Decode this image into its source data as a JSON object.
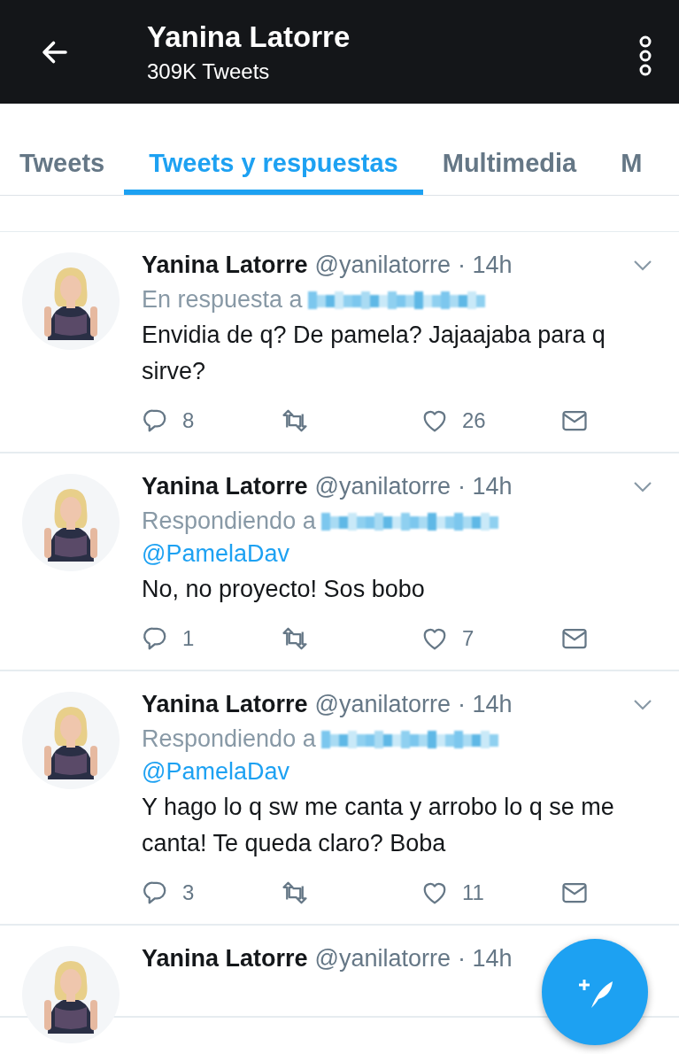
{
  "header": {
    "title": "Yanina Latorre",
    "subtitle": "309K Tweets"
  },
  "tabs": [
    {
      "label": "Tweets",
      "selected": false
    },
    {
      "label": "Tweets y respuestas",
      "selected": true
    },
    {
      "label": "Multimedia",
      "selected": false
    },
    {
      "label": "M",
      "selected": false
    }
  ],
  "tweets": [
    {
      "name": "Yanina Latorre",
      "handle": "@yanilatorre",
      "time": "· 14h",
      "reply_prefix": "En respuesta a",
      "reply_redacted": true,
      "text": "Envidia de q? De pamela? Jajaajaba para q sirve?",
      "replies": "8",
      "likes": "26"
    },
    {
      "name": "Yanina Latorre",
      "handle": "@yanilatorre",
      "time": "· 14h",
      "reply_prefix": "Respondiendo a",
      "reply_redacted": true,
      "reply_mentions": [
        "@PamelaDav"
      ],
      "text": "No, no proyecto! Sos bobo",
      "replies": "1",
      "likes": "7"
    },
    {
      "name": "Yanina Latorre",
      "handle": "@yanilatorre",
      "time": "· 14h",
      "reply_prefix": "Respondiendo a",
      "reply_redacted": true,
      "reply_mentions": [
        "@PamelaDav"
      ],
      "text": "Y hago lo q sw me canta y arrobo lo q se me canta! Te queda claro? Boba",
      "replies": "3",
      "likes": "11"
    },
    {
      "name": "Yanina Latorre",
      "handle": "@yanilatorre",
      "time": "· 14h"
    }
  ]
}
